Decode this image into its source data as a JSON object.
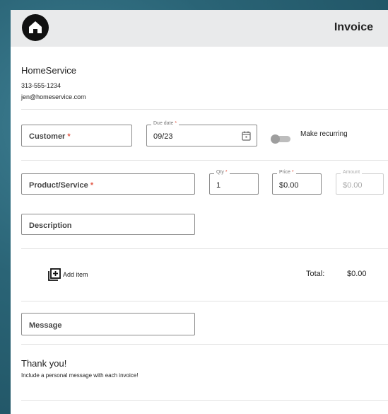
{
  "header": {
    "title": "Invoice",
    "logo_icon": "home-icon"
  },
  "company": {
    "name": "HomeService",
    "phone": "313-555-1234",
    "email": "jen@homeservice.com"
  },
  "form": {
    "customer": {
      "label": "Customer",
      "required": "*"
    },
    "due_date": {
      "label": "Due date",
      "required": "*",
      "value": "09/23",
      "icon": "calendar-icon"
    },
    "recurring": {
      "label": "Make recurring",
      "on": false
    },
    "product": {
      "label": "Product/Service",
      "required": "*"
    },
    "qty": {
      "label": "Qty",
      "required": "*",
      "value": "1"
    },
    "price": {
      "label": "Price",
      "required": "*",
      "value": "$0.00"
    },
    "amount": {
      "label": "Amount",
      "value": "$0.00"
    },
    "description": {
      "label": "Description"
    },
    "add_item": {
      "label": "Add item",
      "icon": "add-box-icon"
    },
    "total": {
      "label": "Total:",
      "value": "$0.00"
    },
    "message": {
      "label": "Message"
    }
  },
  "footer": {
    "title": "Thank you!",
    "subtitle": "Include a personal message with each invoice!"
  },
  "colors": {
    "required": "#e35b4a",
    "header_bg": "#e9eaeb"
  }
}
